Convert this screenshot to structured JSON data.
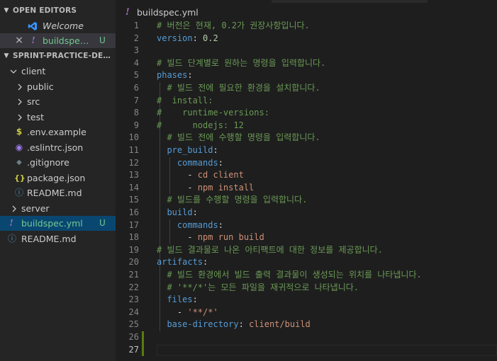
{
  "sidebar": {
    "open_editors_header": "OPEN EDITORS",
    "open_editors": [
      {
        "label": "Welcome",
        "icon": "vscode-logo-icon"
      },
      {
        "close_glyph": "×",
        "label": "buildspec.y...",
        "status": "U",
        "icon": "yaml-icon",
        "icon_glyph": "!"
      }
    ],
    "project_header": "SPRINT-PRACTICE-DEPLOY...",
    "tree": [
      {
        "label": "client",
        "icon": "chevron-down-icon",
        "glyph": "⌵"
      },
      {
        "label": "public",
        "icon": "chevron-right-icon",
        "glyph": "›"
      },
      {
        "label": "src",
        "icon": "chevron-right-icon",
        "glyph": "›"
      },
      {
        "label": "test",
        "icon": "chevron-right-icon",
        "glyph": "›"
      },
      {
        "label": ".env.example",
        "icon": "dollar-icon",
        "glyph": "$"
      },
      {
        "label": ".eslintrc.json",
        "icon": "eslint-icon",
        "glyph": "◉"
      },
      {
        "label": ".gitignore",
        "icon": "git-icon",
        "glyph": "◆"
      },
      {
        "label": "package.json",
        "icon": "json-icon",
        "glyph": "{}"
      },
      {
        "label": "README.md",
        "icon": "info-icon",
        "glyph": "ⓘ"
      },
      {
        "label": "server",
        "icon": "chevron-right-icon",
        "glyph": "›"
      },
      {
        "label": "buildspec.yml",
        "icon": "yaml-icon",
        "glyph": "!",
        "status": "U"
      },
      {
        "label": "README.md",
        "icon": "info-icon",
        "glyph": "ⓘ"
      }
    ]
  },
  "editor": {
    "tab_icon_glyph": "!",
    "tab_title": "buildspec.yml",
    "current_line": 27,
    "lines": [
      [
        {
          "t": "# 버전은 현재, 0.2가 권장사항입니다.",
          "c": "comment"
        }
      ],
      [
        {
          "t": "version",
          "c": "key"
        },
        {
          "t": ": ",
          "c": ""
        },
        {
          "t": "0.2",
          "c": "num"
        }
      ],
      [],
      [
        {
          "t": "# 빌드 단계별로 원하는 명령을 입력합니다.",
          "c": "comment"
        }
      ],
      [
        {
          "t": "phases",
          "c": "key"
        },
        {
          "t": ":",
          "c": ""
        }
      ],
      [
        {
          "t": "  ",
          "c": ""
        },
        {
          "t": "# 빌드 전에 필요한 환경을 설치합니다.",
          "c": "comment"
        }
      ],
      [
        {
          "t": "#  install:",
          "c": "comment"
        }
      ],
      [
        {
          "t": "#    runtime-versions:",
          "c": "comment"
        }
      ],
      [
        {
          "t": "#      nodejs: 12",
          "c": "comment"
        }
      ],
      [
        {
          "t": "  ",
          "c": ""
        },
        {
          "t": "# 빌드 전에 수행할 명령을 입력합니다.",
          "c": "comment"
        }
      ],
      [
        {
          "t": "  ",
          "c": ""
        },
        {
          "t": "pre_build",
          "c": "key"
        },
        {
          "t": ":",
          "c": ""
        }
      ],
      [
        {
          "t": "    ",
          "c": ""
        },
        {
          "t": "commands",
          "c": "key"
        },
        {
          "t": ":",
          "c": ""
        }
      ],
      [
        {
          "t": "      - ",
          "c": ""
        },
        {
          "t": "cd client",
          "c": "str"
        }
      ],
      [
        {
          "t": "      - ",
          "c": ""
        },
        {
          "t": "npm install",
          "c": "str"
        }
      ],
      [
        {
          "t": "  ",
          "c": ""
        },
        {
          "t": "# 빌드를 수행할 명령을 입력합니다.",
          "c": "comment"
        }
      ],
      [
        {
          "t": "  ",
          "c": ""
        },
        {
          "t": "build",
          "c": "key"
        },
        {
          "t": ":",
          "c": ""
        }
      ],
      [
        {
          "t": "    ",
          "c": ""
        },
        {
          "t": "commands",
          "c": "key"
        },
        {
          "t": ":",
          "c": ""
        }
      ],
      [
        {
          "t": "      - ",
          "c": ""
        },
        {
          "t": "npm run build",
          "c": "str"
        }
      ],
      [
        {
          "t": "# 빌드 결과물로 나온 아티팩트에 대한 정보를 제공합니다.",
          "c": "comment"
        }
      ],
      [
        {
          "t": "artifacts",
          "c": "key"
        },
        {
          "t": ":",
          "c": ""
        }
      ],
      [
        {
          "t": "  ",
          "c": ""
        },
        {
          "t": "# 빌드 환경에서 빌드 출력 결과물이 생성되는 위치를 나타냅니다.",
          "c": "comment"
        }
      ],
      [
        {
          "t": "  ",
          "c": ""
        },
        {
          "t": "# '**/*'는 모든 파일을 재귀적으로 나타냅니다.",
          "c": "comment"
        }
      ],
      [
        {
          "t": "  ",
          "c": ""
        },
        {
          "t": "files",
          "c": "key"
        },
        {
          "t": ":",
          "c": ""
        }
      ],
      [
        {
          "t": "    - ",
          "c": ""
        },
        {
          "t": "'**/*'",
          "c": "str"
        }
      ],
      [
        {
          "t": "  ",
          "c": ""
        },
        {
          "t": "base-directory",
          "c": "key"
        },
        {
          "t": ": ",
          "c": ""
        },
        {
          "t": "client/build",
          "c": "str"
        }
      ],
      [],
      []
    ]
  }
}
